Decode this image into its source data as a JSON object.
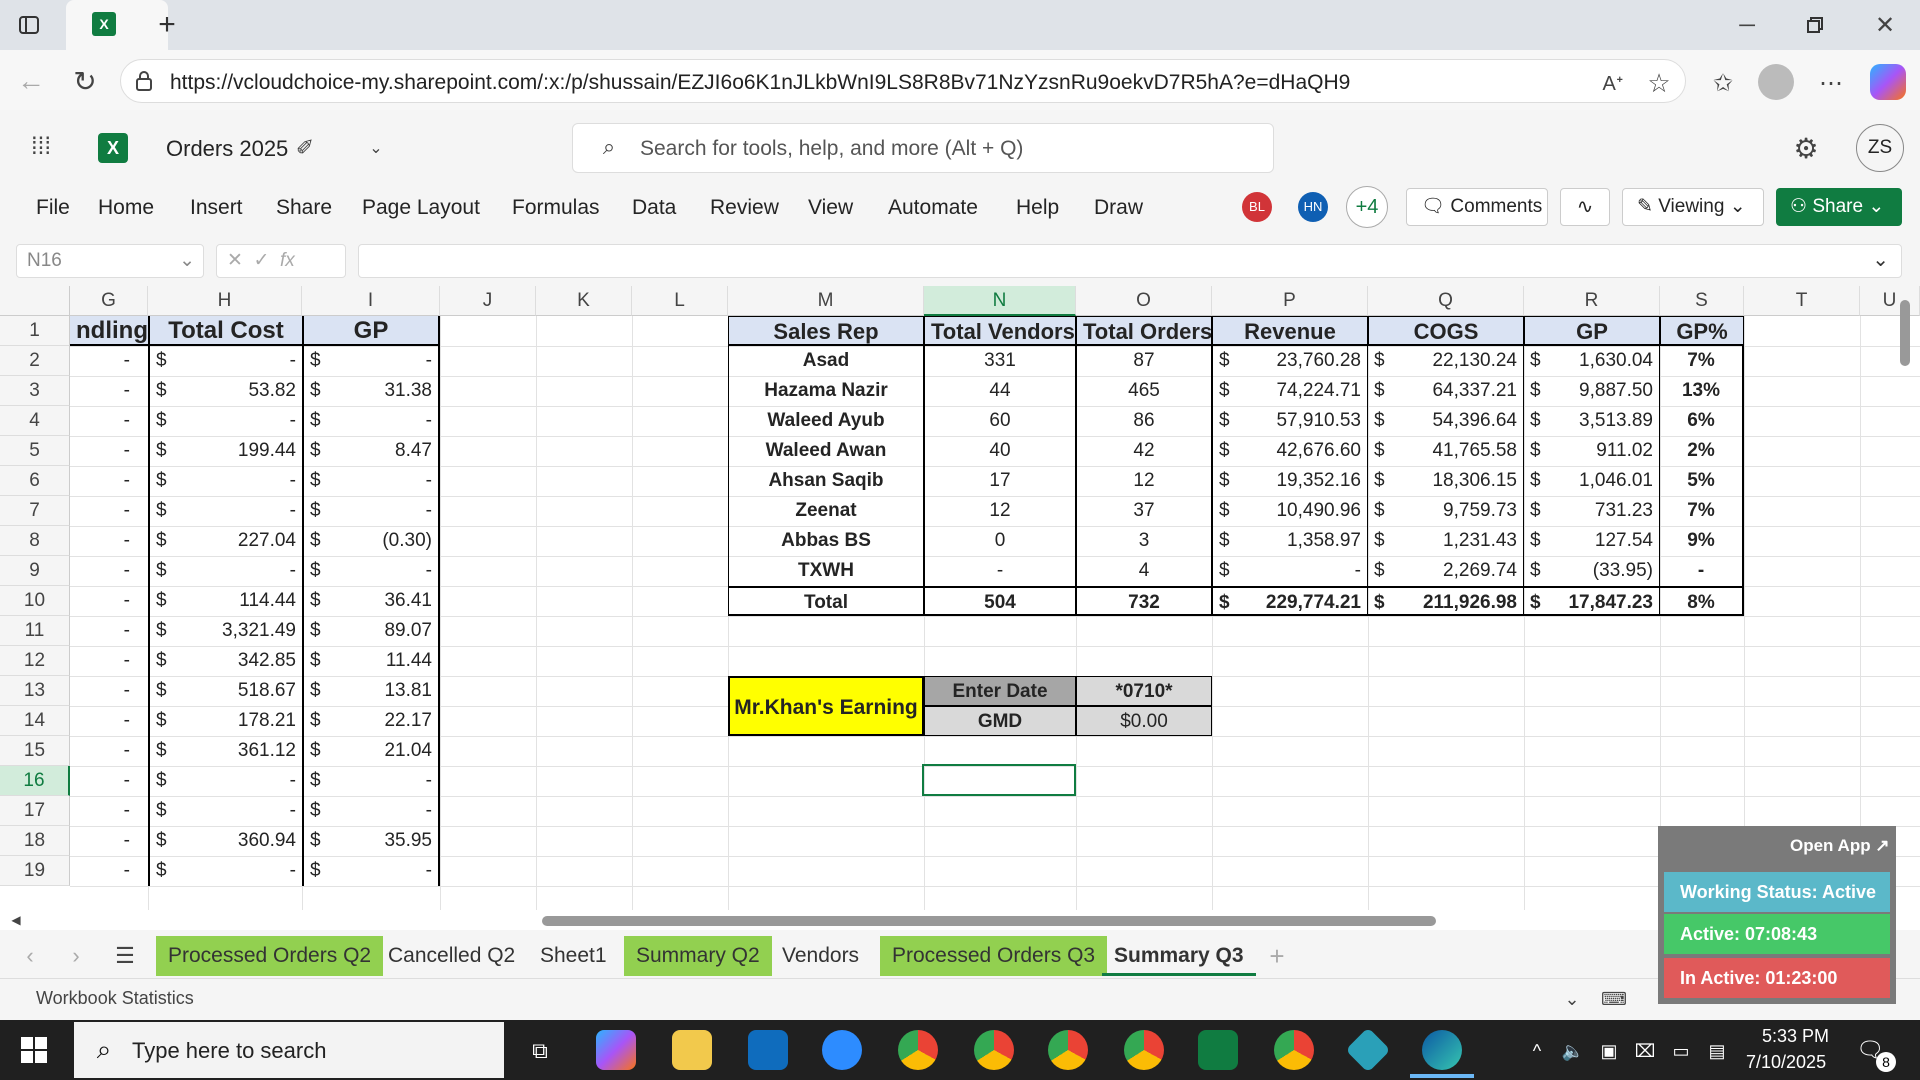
{
  "browser": {
    "url": "https://vcloudchoice-my.sharepoint.com/:x:/p/shussain/EZJI6o6K1nJLkbWnI9LS8R8Bv71NzYzsnRu9oekvD7R5hA?e=dHaQH9"
  },
  "app": {
    "doc_title": "Orders 2025",
    "search_placeholder": "Search for tools, help, and more (Alt + Q)",
    "avatar": "ZS"
  },
  "menu": [
    "File",
    "Home",
    "Insert",
    "Share",
    "Page Layout",
    "Formulas",
    "Data",
    "Review",
    "View",
    "Automate",
    "Help",
    "Draw"
  ],
  "collab": {
    "user1": "BL",
    "user2": "HN",
    "more": "+4",
    "comments": "Comments",
    "viewing": "Viewing",
    "share": "Share"
  },
  "formula": {
    "namebox": "N16"
  },
  "columns": [
    "G",
    "H",
    "I",
    "J",
    "K",
    "L",
    "M",
    "N",
    "O",
    "P",
    "Q",
    "R",
    "S",
    "T",
    "U"
  ],
  "rows": [
    "1",
    "2",
    "3",
    "4",
    "5",
    "6",
    "7",
    "8",
    "9",
    "10",
    "11",
    "12",
    "13",
    "14",
    "15",
    "16",
    "17",
    "18",
    "19"
  ],
  "left_table": {
    "headers": [
      "ndling",
      "Total Cost",
      "GP"
    ],
    "rows": [
      [
        "-",
        "$",
        "-",
        "$",
        "-"
      ],
      [
        "-",
        "$",
        "53.82",
        "$",
        "31.38"
      ],
      [
        "-",
        "$",
        "-",
        "$",
        "-"
      ],
      [
        "-",
        "$",
        "199.44",
        "$",
        "8.47"
      ],
      [
        "-",
        "$",
        "-",
        "$",
        "-"
      ],
      [
        "-",
        "$",
        "-",
        "$",
        "-"
      ],
      [
        "-",
        "$",
        "227.04",
        "$",
        "(0.30)"
      ],
      [
        "-",
        "$",
        "-",
        "$",
        "-"
      ],
      [
        "-",
        "$",
        "114.44",
        "$",
        "36.41"
      ],
      [
        "-",
        "$",
        "3,321.49",
        "$",
        "89.07"
      ],
      [
        "-",
        "$",
        "342.85",
        "$",
        "11.44"
      ],
      [
        "-",
        "$",
        "518.67",
        "$",
        "13.81"
      ],
      [
        "-",
        "$",
        "178.21",
        "$",
        "22.17"
      ],
      [
        "-",
        "$",
        "361.12",
        "$",
        "21.04"
      ],
      [
        "-",
        "$",
        "-",
        "$",
        "-"
      ],
      [
        "-",
        "$",
        "-",
        "$",
        "-"
      ],
      [
        "-",
        "$",
        "360.94",
        "$",
        "35.95"
      ],
      [
        "-",
        "$",
        "-",
        "$",
        "-"
      ]
    ]
  },
  "summary": {
    "headers": [
      "Sales Rep",
      "Total Vendors",
      "Total Orders",
      "Revenue",
      "COGS",
      "GP",
      "GP%"
    ],
    "rows": [
      [
        "Asad",
        "331",
        "87",
        "$",
        "23,760.28",
        "$",
        "22,130.24",
        "$",
        "1,630.04",
        "7%"
      ],
      [
        "Hazama Nazir",
        "44",
        "465",
        "$",
        "74,224.71",
        "$",
        "64,337.21",
        "$",
        "9,887.50",
        "13%"
      ],
      [
        "Waleed Ayub",
        "60",
        "86",
        "$",
        "57,910.53",
        "$",
        "54,396.64",
        "$",
        "3,513.89",
        "6%"
      ],
      [
        "Waleed Awan",
        "40",
        "42",
        "$",
        "42,676.60",
        "$",
        "41,765.58",
        "$",
        "911.02",
        "2%"
      ],
      [
        "Ahsan Saqib",
        "17",
        "12",
        "$",
        "19,352.16",
        "$",
        "18,306.15",
        "$",
        "1,046.01",
        "5%"
      ],
      [
        "Zeenat",
        "12",
        "37",
        "$",
        "10,490.96",
        "$",
        "9,759.73",
        "$",
        "731.23",
        "7%"
      ],
      [
        "Abbas BS",
        "0",
        "3",
        "$",
        "1,358.97",
        "$",
        "1,231.43",
        "$",
        "127.54",
        "9%"
      ],
      [
        "TXWH",
        "-",
        "4",
        "$",
        "-",
        "$",
        "2,269.74",
        "$",
        "(33.95)",
        "-"
      ],
      [
        "Total",
        "504",
        "732",
        "$",
        "229,774.21",
        "$",
        "211,926.98",
        "$",
        "17,847.23",
        "8%"
      ]
    ]
  },
  "earning": {
    "label": "Mr.Khan's Earning",
    "enter_date": "Enter Date",
    "date_value": "*0710*",
    "gmd": "GMD",
    "gmd_value": "$0.00"
  },
  "sheet_tabs": [
    "Processed Orders Q2",
    "Cancelled Q2",
    "Sheet1",
    "Summary Q2",
    "Vendors",
    "Processed Orders Q3",
    "Summary Q3"
  ],
  "status": {
    "left": "Workbook Statistics"
  },
  "widget": {
    "open_app": "Open App ↗",
    "working": "Working Status: Active",
    "active": "Active: 07:08:43",
    "inactive": "In Active: 01:23:00"
  },
  "taskbar": {
    "search": "Type here to search",
    "time": "5:33 PM",
    "date": "7/10/2025",
    "notif": "8"
  }
}
